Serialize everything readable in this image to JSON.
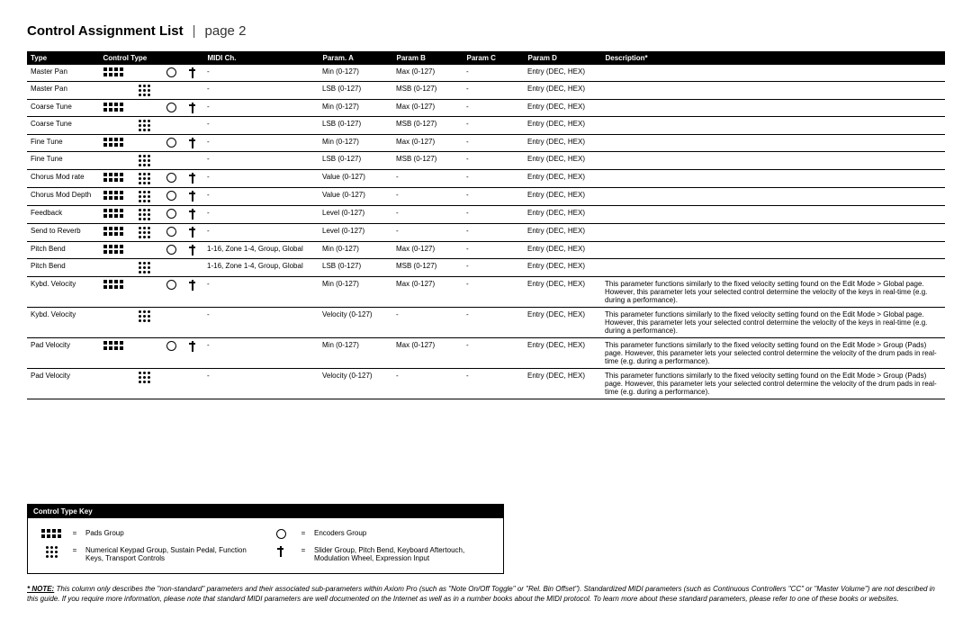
{
  "header": {
    "title": "Control Assignment List",
    "divider": "|",
    "page_label": "page 2"
  },
  "columns": {
    "type": "Type",
    "control_type": "Control Type",
    "midi": "MIDI Ch.",
    "pa": "Param. A",
    "pb": "Param B",
    "pc": "Param C",
    "pd": "Param D",
    "desc": "Description*"
  },
  "rows": [
    {
      "type": "Master Pan",
      "g": [
        "pads",
        "",
        "ring",
        "slider"
      ],
      "midi": "-",
      "pa": "Min (0-127)",
      "pb": "Max (0-127)",
      "pc": "-",
      "pd": "Entry (DEC, HEX)",
      "desc": ""
    },
    {
      "type": "Master Pan",
      "g": [
        "",
        "dots3",
        "",
        ""
      ],
      "midi": "-",
      "pa": "LSB (0-127)",
      "pb": "MSB (0-127)",
      "pc": "-",
      "pd": "Entry (DEC, HEX)",
      "desc": ""
    },
    {
      "type": "Coarse Tune",
      "g": [
        "pads",
        "",
        "ring",
        "slider"
      ],
      "midi": "-",
      "pa": "Min (0-127)",
      "pb": "Max (0-127)",
      "pc": "-",
      "pd": "Entry (DEC, HEX)",
      "desc": ""
    },
    {
      "type": "Coarse Tune",
      "g": [
        "",
        "dots3",
        "",
        ""
      ],
      "midi": "-",
      "pa": "LSB (0-127)",
      "pb": "MSB (0-127)",
      "pc": "-",
      "pd": "Entry (DEC, HEX)",
      "desc": ""
    },
    {
      "type": "Fine Tune",
      "g": [
        "pads",
        "",
        "ring",
        "slider"
      ],
      "midi": "-",
      "pa": "Min (0-127)",
      "pb": "Max (0-127)",
      "pc": "-",
      "pd": "Entry (DEC, HEX)",
      "desc": ""
    },
    {
      "type": "Fine Tune",
      "g": [
        "",
        "dots3",
        "",
        ""
      ],
      "midi": "-",
      "pa": "LSB (0-127)",
      "pb": "MSB (0-127)",
      "pc": "-",
      "pd": "Entry (DEC, HEX)",
      "desc": ""
    },
    {
      "type": "Chorus Mod rate",
      "g": [
        "pads",
        "dots3",
        "ring",
        "slider"
      ],
      "midi": "-",
      "pa": "Value (0-127)",
      "pb": "-",
      "pc": "-",
      "pd": "Entry (DEC, HEX)",
      "desc": ""
    },
    {
      "type": "Chorus Mod Depth",
      "g": [
        "pads",
        "dots3",
        "ring",
        "slider"
      ],
      "midi": "-",
      "pa": "Value (0-127)",
      "pb": "-",
      "pc": "-",
      "pd": "Entry (DEC, HEX)",
      "desc": ""
    },
    {
      "type": "Feedback",
      "g": [
        "pads",
        "dots3",
        "ring",
        "slider"
      ],
      "midi": "-",
      "pa": "Level (0-127)",
      "pb": "-",
      "pc": "-",
      "pd": "Entry (DEC, HEX)",
      "desc": ""
    },
    {
      "type": "Send to Reverb",
      "g": [
        "pads",
        "dots3",
        "ring",
        "slider"
      ],
      "midi": "-",
      "pa": "Level (0-127)",
      "pb": "-",
      "pc": "-",
      "pd": "Entry (DEC, HEX)",
      "desc": ""
    },
    {
      "type": "Pitch Bend",
      "g": [
        "pads",
        "",
        "ring",
        "slider"
      ],
      "midi": "1-16, Zone 1-4, Group, Global",
      "pa": "Min (0-127)",
      "pb": "Max (0-127)",
      "pc": "-",
      "pd": "Entry (DEC, HEX)",
      "desc": ""
    },
    {
      "type": "Pitch Bend",
      "g": [
        "",
        "dots3",
        "",
        ""
      ],
      "midi": "1-16, Zone 1-4, Group, Global",
      "pa": "LSB (0-127)",
      "pb": "MSB (0-127)",
      "pc": "-",
      "pd": "Entry (DEC, HEX)",
      "desc": ""
    },
    {
      "type": "Kybd. Velocity",
      "g": [
        "pads",
        "",
        "ring",
        "slider"
      ],
      "midi": "-",
      "pa": "Min (0-127)",
      "pb": "Max (0-127)",
      "pc": "-",
      "pd": "Entry (DEC, HEX)",
      "desc": "This parameter functions similarly to the fixed velocity setting found on the Edit Mode > Global page. However, this parameter lets your selected control determine the velocity of the keys in real-time (e.g. during a performance)."
    },
    {
      "type": "Kybd. Velocity",
      "g": [
        "",
        "dots3",
        "",
        ""
      ],
      "midi": "-",
      "pa": "Velocity (0-127)",
      "pb": "-",
      "pc": "-",
      "pd": "Entry (DEC, HEX)",
      "desc": "This parameter functions similarly to the fixed velocity setting found on the Edit Mode > Global page. However, this parameter lets your selected control determine the velocity of the keys in real-time (e.g. during a performance)."
    },
    {
      "type": "Pad Velocity",
      "g": [
        "pads",
        "",
        "ring",
        "slider"
      ],
      "midi": "-",
      "pa": "Min (0-127)",
      "pb": "Max (0-127)",
      "pc": "-",
      "pd": "Entry (DEC, HEX)",
      "desc": "This parameter functions similarly to the fixed velocity setting found on the Edit Mode > Group (Pads) page. However, this parameter lets your selected control determine the velocity of the drum pads in real-time (e.g. during a performance)."
    },
    {
      "type": "Pad Velocity",
      "g": [
        "",
        "dots3",
        "",
        ""
      ],
      "midi": "-",
      "pa": "Velocity (0-127)",
      "pb": "-",
      "pc": "-",
      "pd": "Entry (DEC, HEX)",
      "desc": "This parameter functions similarly to the fixed velocity setting found on the Edit Mode > Group (Pads) page. However, this parameter lets your selected control determine the velocity of the drum pads in real-time (e.g. during a performance)."
    }
  ],
  "key": {
    "title": "Control Type Key",
    "eq": "=",
    "items": [
      {
        "g": "pads",
        "t": "Pads Group"
      },
      {
        "g": "ring",
        "t": "Encoders Group"
      },
      {
        "g": "dots3",
        "t": "Numerical Keypad Group, Sustain Pedal, Function Keys, Transport Controls"
      },
      {
        "g": "slider",
        "t": "Slider Group, Pitch Bend, Keyboard Aftertouch, Modulation Wheel, Expression Input"
      }
    ]
  },
  "note": {
    "label": "* NOTE:",
    "text": "This column only describes the \"non-standard\" parameters and their associated sub-parameters within Axiom Pro (such as \"Note On/Off Toggle\" or \"Rel. Bin Offset\"). Standardized MIDI parameters (such as Continuous Controllers \"CC\" or \"Master Volume\") are not described in this guide.  If you require more information, please note that standard MIDI parameters are well documented on the Internet as well as in a number books about the MIDI protocol.  To learn more about these standard parameters, please refer to one of these books or websites."
  }
}
